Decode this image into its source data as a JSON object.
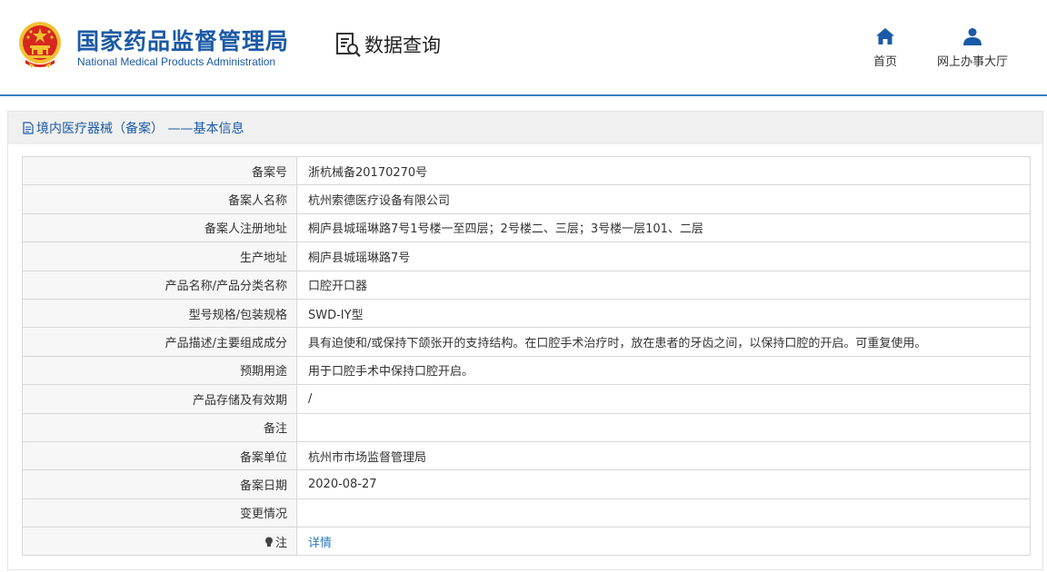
{
  "header": {
    "title_cn": "国家药品监督管理局",
    "title_en": "National Medical Products Administration",
    "data_query": "数据查询",
    "nav": [
      {
        "label": "首页",
        "icon": "home-icon"
      },
      {
        "label": "网上办事大厅",
        "icon": "user-icon"
      }
    ]
  },
  "panel": {
    "title": "境内医疗器械（备案） ——基本信息",
    "rows": [
      {
        "key": "备案号",
        "value": "浙杭械备20170270号"
      },
      {
        "key": "备案人名称",
        "value": "杭州索德医疗设备有限公司"
      },
      {
        "key": "备案人注册地址",
        "value": "桐庐县城瑶琳路7号1号楼一至四层；2号楼二、三层；3号楼一层101、二层"
      },
      {
        "key": "生产地址",
        "value": "桐庐县城瑶琳路7号"
      },
      {
        "key": "产品名称/产品分类名称",
        "value": "口腔开口器"
      },
      {
        "key": "型号规格/包装规格",
        "value": "SWD-IY型"
      },
      {
        "key": "产品描述/主要组成成分",
        "value": "具有迫使和/或保持下颌张开的支持结构。在口腔手术治疗时，放在患者的牙齿之间，以保持口腔的开启。可重复使用。"
      },
      {
        "key": "预期用途",
        "value": "用于口腔手术中保持口腔开启。"
      },
      {
        "key": "产品存储及有效期",
        "value": "/"
      },
      {
        "key": "备注",
        "value": ""
      },
      {
        "key": "备案单位",
        "value": "杭州市市场监督管理局"
      },
      {
        "key": "备案日期",
        "value": "2020-08-27"
      },
      {
        "key": "变更情况",
        "value": ""
      }
    ],
    "note_key": "注",
    "note_link": "详情"
  },
  "colors": {
    "brand_blue": "#1b5aa6",
    "link_blue": "#2a7ac2",
    "emblem_red": "#d7261e",
    "emblem_gold": "#f1c232"
  }
}
